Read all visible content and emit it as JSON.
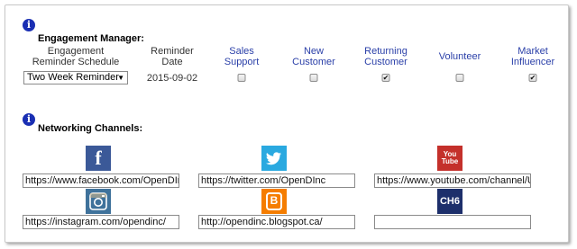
{
  "engagement": {
    "title": "Engagement Manager:",
    "columns": [
      {
        "label": "Engagement\nReminder Schedule",
        "color": "black"
      },
      {
        "label": "Reminder\nDate",
        "color": "black"
      },
      {
        "label": "Sales\nSupport",
        "color": "blue"
      },
      {
        "label": "New\nCustomer",
        "color": "blue"
      },
      {
        "label": "Returning\nCustomer",
        "color": "blue"
      },
      {
        "label": "Volunteer",
        "color": "blue"
      },
      {
        "label": "Market\nInfluencer",
        "color": "blue"
      }
    ],
    "schedule_value": "Two Week Reminder",
    "reminder_date": "2015-09-02",
    "checkboxes": {
      "sales_support": false,
      "new_customer": false,
      "returning_customer": true,
      "volunteer": false,
      "market_influencer": true
    }
  },
  "networking": {
    "title": "Networking Channels:",
    "channels": [
      {
        "name": "facebook",
        "icon": "facebook-icon",
        "icon_text": "f",
        "color": "#3b5998",
        "url": "https://www.facebook.com/OpenDInc"
      },
      {
        "name": "twitter",
        "icon": "twitter-icon",
        "icon_text": "🐦",
        "color": "#2aa9e0",
        "url": "https://twitter.com/OpenDInc"
      },
      {
        "name": "youtube",
        "icon": "youtube-icon",
        "icon_text": "You Tube",
        "color": "#c4302b",
        "url": "https://www.youtube.com/channel/UCpM"
      },
      {
        "name": "instagram",
        "icon": "instagram-icon",
        "icon_text": "",
        "color": "#3f729b",
        "url": "https://instagram.com/opendinc/"
      },
      {
        "name": "blogger",
        "icon": "blogger-icon",
        "icon_text": "B",
        "color": "#f57d00",
        "url": "http://opendinc.blogspot.ca/"
      },
      {
        "name": "ch6",
        "icon": "ch6-icon",
        "icon_text": "CH6",
        "color": "#1d2f6b",
        "url": ""
      }
    ]
  },
  "colors": {
    "info_icon": "#1a2fb3",
    "column_blue": "#2a3fa8"
  }
}
